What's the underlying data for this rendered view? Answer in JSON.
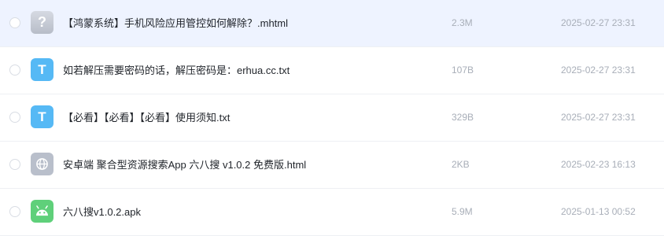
{
  "files": [
    {
      "icon": "question-mark-icon",
      "name": "【鸿蒙系统】手机风险应用管控如何解除？.mhtml",
      "size": "2.3M",
      "date": "2025-02-27 23:31",
      "selected": true
    },
    {
      "icon": "text-file-icon",
      "name": "如若解压需要密码的话，解压密码是：erhua.cc.txt",
      "size": "107B",
      "date": "2025-02-27 23:31",
      "selected": false
    },
    {
      "icon": "text-file-icon",
      "name": "【必看】【必看】【必看】使用须知.txt",
      "size": "329B",
      "date": "2025-02-27 23:31",
      "selected": false
    },
    {
      "icon": "web-page-icon",
      "name": "安卓端 聚合型资源搜索App 六八搜 v1.0.2 免费版.html",
      "size": "2KB",
      "date": "2025-02-23 16:13",
      "selected": false
    },
    {
      "icon": "android-icon",
      "name": "六八搜v1.0.2.apk",
      "size": "5.9M",
      "date": "2025-01-13 00:52",
      "selected": false
    }
  ],
  "icon_glyphs": {
    "text_file": "T",
    "unknown": "?"
  },
  "colors": {
    "selected_row": "#eef3ff",
    "text_icon": "#56b9f5",
    "android_icon": "#5fd07a",
    "muted_text": "#a8aeb8"
  }
}
